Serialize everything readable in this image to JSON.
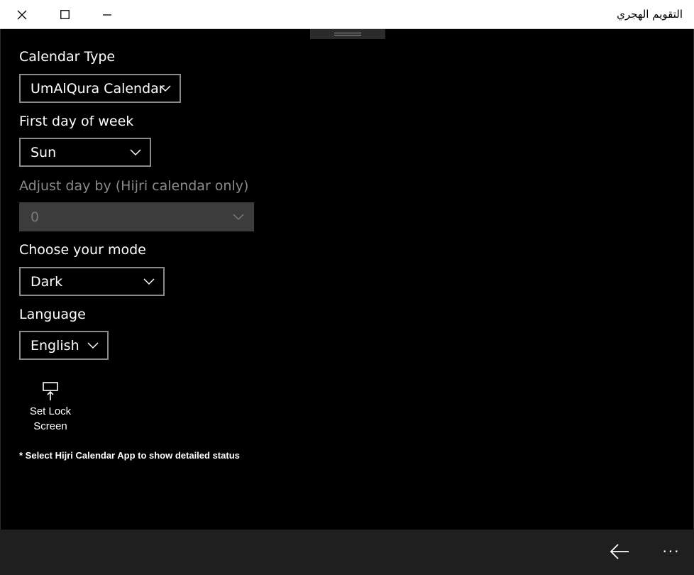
{
  "window": {
    "title": "التقويم الهجري",
    "close_glyph": "✕",
    "maximize_glyph": "☐",
    "minimize_glyph": "—"
  },
  "settings": {
    "calendar_type": {
      "label": "Calendar Type",
      "value": "UmAlQura Calendar"
    },
    "first_day": {
      "label": "First day of week",
      "value": "Sun"
    },
    "adjust_day": {
      "label": "Adjust day by (Hijri calendar only)",
      "value": "0",
      "disabled": true
    },
    "mode": {
      "label": "Choose your mode",
      "value": "Dark"
    },
    "language": {
      "label": "Language",
      "value": "English"
    }
  },
  "lock_screen": {
    "line1": "Set Lock",
    "line2": "Screen",
    "icon": "lock-screen-icon"
  },
  "note": "* Select Hijri Calendar App to show detailed status",
  "appbar": {
    "more_glyph": "···",
    "back_icon": "back-arrow-icon"
  },
  "colors": {
    "background": "#000000",
    "border": "#8a8a8a",
    "disabled": "#3c3c3c",
    "appbar": "#1f1f1f"
  }
}
